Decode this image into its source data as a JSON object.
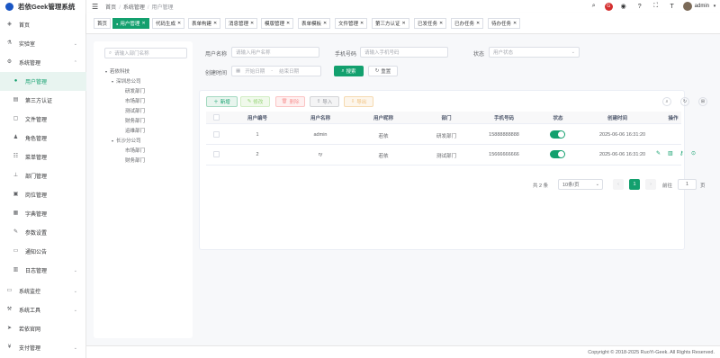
{
  "app": {
    "title": "若依Geek管理系统"
  },
  "sidebar": {
    "items": [
      {
        "label": "首页",
        "icon": "dashboard-icon"
      },
      {
        "label": "实验室",
        "icon": "lab-icon"
      },
      {
        "label": "系统管理",
        "icon": "gear-icon"
      },
      {
        "label": "用户管理",
        "icon": "user-icon"
      },
      {
        "label": "第三方认证",
        "icon": "auth-icon"
      },
      {
        "label": "文件管理",
        "icon": "file-icon"
      },
      {
        "label": "角色管理",
        "icon": "role-icon"
      },
      {
        "label": "菜单管理",
        "icon": "menu-icon"
      },
      {
        "label": "部门管理",
        "icon": "tree-icon"
      },
      {
        "label": "岗位管理",
        "icon": "post-icon"
      },
      {
        "label": "字典管理",
        "icon": "dict-icon"
      },
      {
        "label": "参数设置",
        "icon": "edit-icon"
      },
      {
        "label": "通知公告",
        "icon": "message-icon"
      },
      {
        "label": "日志管理",
        "icon": "log-icon"
      },
      {
        "label": "系统监控",
        "icon": "monitor-icon"
      },
      {
        "label": "系统工具",
        "icon": "tool-icon"
      },
      {
        "label": "若依官网",
        "icon": "guide-icon"
      },
      {
        "label": "支付管理",
        "icon": "pay-icon"
      }
    ]
  },
  "header": {
    "breadcrumb": [
      "首页",
      "系统管理",
      "用户管理"
    ],
    "username": "admin"
  },
  "tags": [
    {
      "label": "首页"
    },
    {
      "label": "用户管理"
    },
    {
      "label": "代码生成"
    },
    {
      "label": "表单构建"
    },
    {
      "label": "消息管理"
    },
    {
      "label": "模版管理"
    },
    {
      "label": "表单模板"
    },
    {
      "label": "文件管理"
    },
    {
      "label": "第三方认证"
    },
    {
      "label": "已发任务"
    },
    {
      "label": "已办任务"
    },
    {
      "label": "待办任务"
    }
  ],
  "dept": {
    "search_placeholder": "请输入部门名称",
    "tree": [
      "若依科技",
      "深圳总公司",
      "研发部门",
      "市场部门",
      "测试部门",
      "财务部门",
      "运维部门",
      "长沙分公司",
      "市场部门",
      "财务部门"
    ]
  },
  "search": {
    "username_label": "用户名称",
    "username_placeholder": "请输入用户名称",
    "phone_label": "手机号码",
    "phone_placeholder": "请输入手机号码",
    "status_label": "状态",
    "status_placeholder": "用户状态",
    "time_label": "创建时间",
    "start_placeholder": "开始日期",
    "range_sep": "-",
    "end_placeholder": "结束日期",
    "search_btn": "搜索",
    "reset_btn": "重置"
  },
  "toolbar": {
    "add": "新增",
    "edit": "修改",
    "delete": "删除",
    "import": "导入",
    "export": "导出"
  },
  "table": {
    "headers": [
      "用户编号",
      "用户名称",
      "用户昵称",
      "部门",
      "手机号码",
      "状态",
      "创建时间",
      "操作"
    ],
    "rows": [
      {
        "id": "1",
        "username": "admin",
        "nickname": "若依",
        "dept": "研发部门",
        "phone": "15888888888",
        "status": true,
        "created": "2025-06-06 16:31:20"
      },
      {
        "id": "2",
        "username": "ry",
        "nickname": "若依",
        "dept": "测试部门",
        "phone": "15666666666",
        "status": true,
        "created": "2025-06-06 16:31:20"
      }
    ]
  },
  "pagination": {
    "total": "共 2 条",
    "page_size": "10条/页",
    "current": "1",
    "goto_label": "前往",
    "goto_value": "1",
    "page_unit": "页"
  },
  "footer": {
    "copyright": "Copyright © 2018-2025 RuoYi-Geek. All Rights Reserved."
  },
  "colors": {
    "accent": "#13a06e",
    "edit": "#95d475",
    "delete": "#f89898",
    "import": "#909399",
    "export": "#eebe77"
  }
}
